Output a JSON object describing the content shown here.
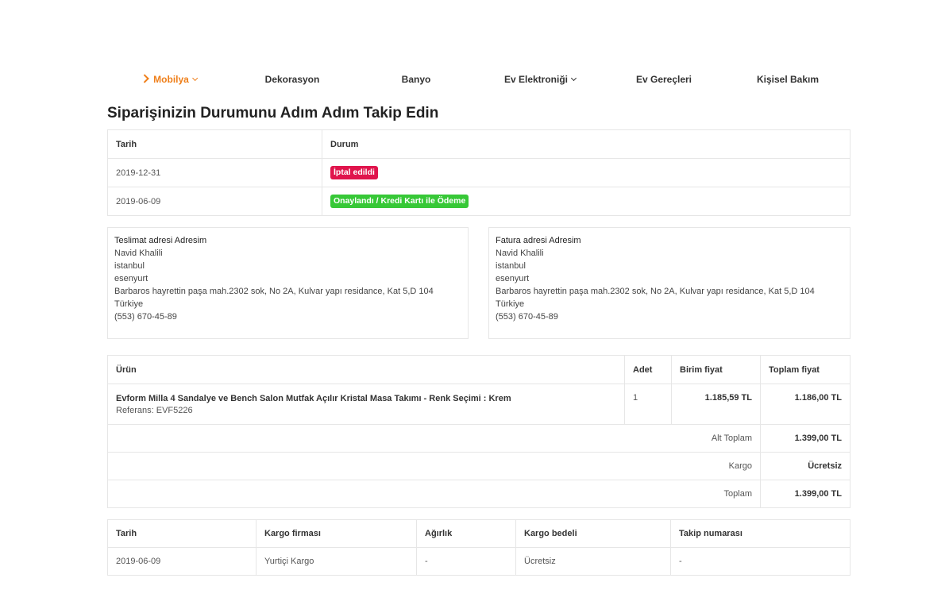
{
  "nav": {
    "items": [
      {
        "label": "Mobilya",
        "active": true,
        "has_dropdown": true
      },
      {
        "label": "Dekorasyon",
        "active": false,
        "has_dropdown": false
      },
      {
        "label": "Banyo",
        "active": false,
        "has_dropdown": false
      },
      {
        "label": "Ev Elektroniği",
        "active": false,
        "has_dropdown": true
      },
      {
        "label": "Ev Gereçleri",
        "active": false,
        "has_dropdown": false
      },
      {
        "label": "Kişisel Bakım",
        "active": false,
        "has_dropdown": false
      }
    ]
  },
  "page": {
    "title": "Siparişinizin Durumunu Adım Adım Takip Edin"
  },
  "status_table": {
    "headers": [
      "Tarih",
      "Durum"
    ],
    "rows": [
      {
        "date": "2019-12-31",
        "status": "İptal edildi",
        "color": "#e0144c"
      },
      {
        "date": "2019-06-09",
        "status": "Onaylandı / Kredi Kartı ile Ödeme",
        "color": "#37c837"
      }
    ]
  },
  "delivery_address": {
    "title": "Teslimat adresi Adresim",
    "name": "Navid Khalili",
    "city": "istanbul",
    "district": "esenyurt",
    "street": "Barbaros hayrettin paşa mah.2302 sok, No 2A, Kulvar yapı residance, Kat 5,D 104",
    "country": "Türkiye",
    "phone": "(553) 670-45-89"
  },
  "billing_address": {
    "title": "Fatura adresi Adresim",
    "name": "Navid Khalili",
    "city": "istanbul",
    "district": "esenyurt",
    "street": "Barbaros hayrettin paşa mah.2302 sok, No 2A, Kulvar yapı residance, Kat 5,D 104",
    "country": "Türkiye",
    "phone": "(553) 670-45-89"
  },
  "items_table": {
    "headers": {
      "product": "Ürün",
      "qty": "Adet",
      "unit_price": "Birim fiyat",
      "total_price": "Toplam fiyat"
    },
    "item": {
      "name": "Evform Milla 4 Sandalye ve Bench Salon Mutfak Açılır Kristal Masa Takımı - Renk Seçimi : Krem",
      "reference": "Referans: EVF5226",
      "qty": "1",
      "unit_price": "1.185,59 TL",
      "total_price": "1.186,00 TL"
    },
    "subtotal": {
      "label": "Alt Toplam",
      "value": "1.399,00 TL"
    },
    "shipping": {
      "label": "Kargo",
      "value": "Ücretsiz"
    },
    "total": {
      "label": "Toplam",
      "value": "1.399,00 TL"
    }
  },
  "shipping_table": {
    "headers": [
      "Tarih",
      "Kargo firması",
      "Ağırlık",
      "Kargo bedeli",
      "Takip numarası"
    ],
    "row": {
      "date": "2019-06-09",
      "carrier": "Yurtiçi Kargo",
      "weight": "-",
      "cost": "Ücretsiz",
      "tracking": "-"
    }
  }
}
